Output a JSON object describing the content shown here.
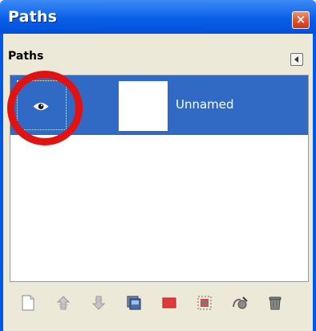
{
  "window": {
    "title": "Paths",
    "close_label": "×"
  },
  "dock": {
    "tab_label": "Paths"
  },
  "paths": {
    "items": [
      {
        "name": "Unnamed",
        "visible": true,
        "selected": true
      }
    ]
  },
  "toolbar": {
    "buttons": [
      {
        "name": "new-path",
        "icon": "new-document-icon"
      },
      {
        "name": "raise-path",
        "icon": "raise-icon"
      },
      {
        "name": "lower-path",
        "icon": "lower-icon"
      },
      {
        "name": "duplicate-path",
        "icon": "duplicate-icon"
      },
      {
        "name": "path-to-selection",
        "icon": "path-to-selection-icon"
      },
      {
        "name": "selection-to-path",
        "icon": "selection-to-path-icon"
      },
      {
        "name": "stroke-path",
        "icon": "stroke-path-icon"
      },
      {
        "name": "delete-path",
        "icon": "trash-icon"
      }
    ]
  },
  "colors": {
    "titlebar": "#0a5fe8",
    "selection": "#316ac5",
    "annotation_ring": "#e01212"
  }
}
